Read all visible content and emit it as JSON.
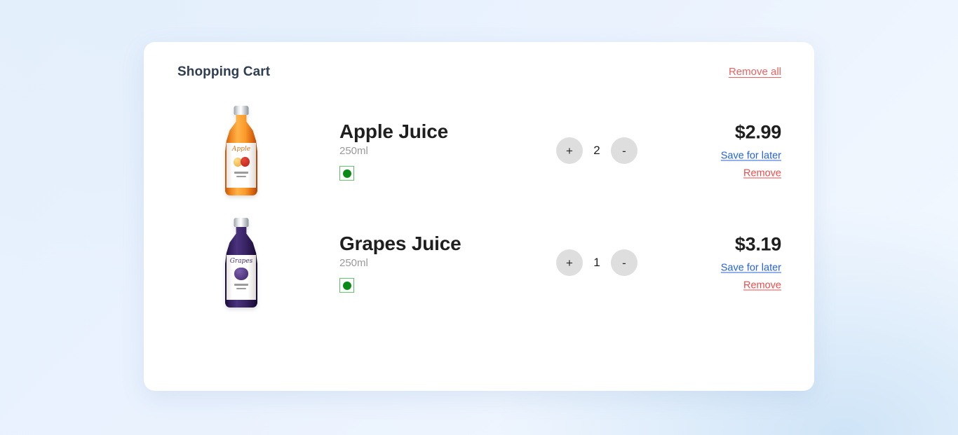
{
  "page": {
    "background_color": "#e6f0fd",
    "card_background": "#ffffff"
  },
  "cart": {
    "title": "Shopping Cart",
    "remove_all_label": "Remove all",
    "accent_colors": {
      "remove": "#ef4b4b",
      "remove_all": "#f0605f",
      "save_for_later": "#2563d8",
      "title": "#2f3e50",
      "veg_mark": "#0a8a17"
    },
    "items": [
      {
        "name": "Apple Juice",
        "volume": "250ml",
        "diet_mark": "vegetarian",
        "quantity": "2",
        "price": "$2.99",
        "increment_label": "+",
        "decrement_label": "-",
        "save_for_later_label": "Save for later",
        "remove_label": "Remove",
        "image_alt": "apple-juice-bottle",
        "brand_text": "Apple"
      },
      {
        "name": "Grapes Juice",
        "volume": "250ml",
        "diet_mark": "vegetarian",
        "quantity": "1",
        "price": "$3.19",
        "increment_label": "+",
        "decrement_label": "-",
        "save_for_later_label": "Save for later",
        "remove_label": "Remove",
        "image_alt": "grapes-juice-bottle",
        "brand_text": "Grapes"
      }
    ]
  }
}
